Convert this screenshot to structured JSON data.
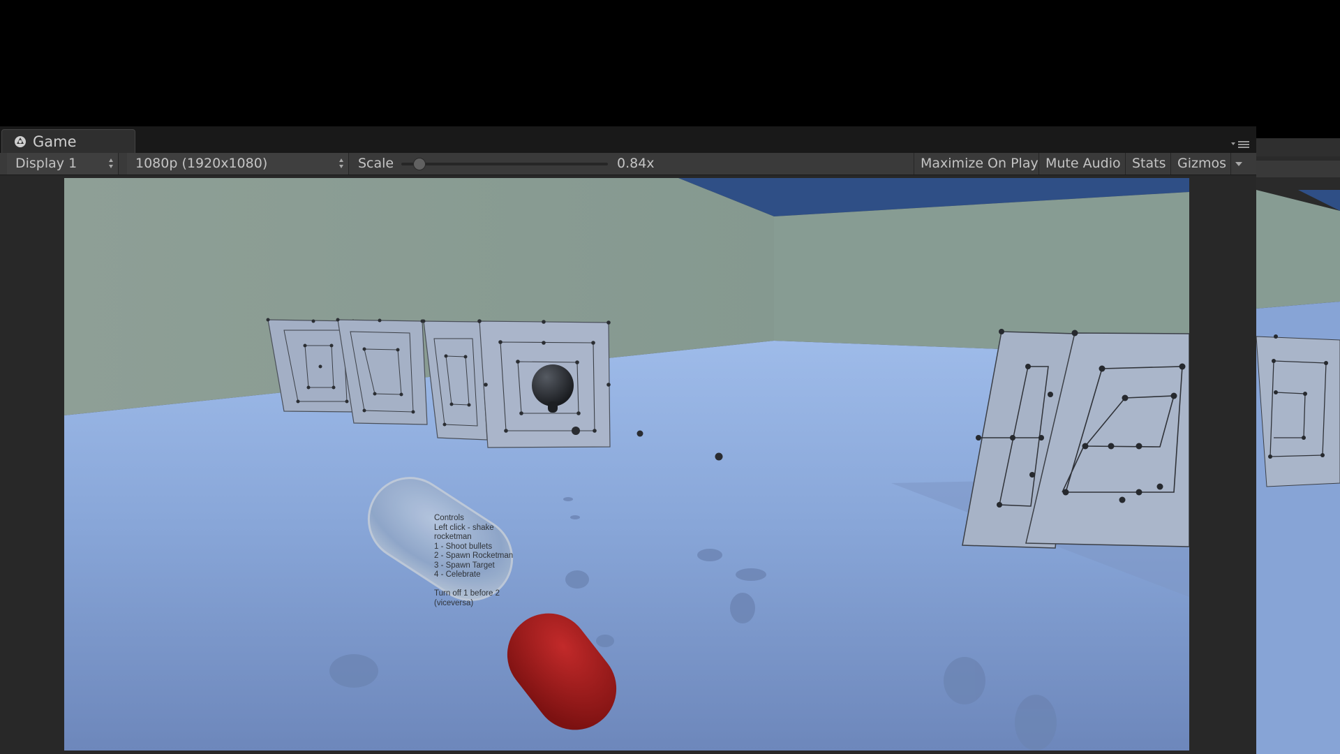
{
  "window": {
    "tab_label": "Game"
  },
  "toolbar": {
    "display_select": "Display 1",
    "resolution_select": "1080p (1920x1080)",
    "scale_label": "Scale",
    "scale_value_text": "0.84x",
    "scale_slider_fraction": 0.06,
    "maximize_label": "Maximize On Play",
    "mute_label": "Mute Audio",
    "stats_label": "Stats",
    "gizmos_label": "Gizmos"
  },
  "scene": {
    "controls_lines": [
      "Controls",
      "Left click - shake",
      "rocketman",
      "1 - Shoot bullets",
      "2 - Spawn Rocketman",
      "3 - Spawn Target",
      "4 - Celebrate",
      "",
      "Turn off 1 before 2",
      "(viceversa)"
    ]
  },
  "colors": {
    "editor_bg": "#282828",
    "toolbar_bg": "#3a3a3a",
    "floor": "#8eaee0",
    "wall": "#8a9d94",
    "sky": "#2e4f8a",
    "red_capsule": "#a21c1c",
    "ghost_capsule": "#9db3d4"
  }
}
